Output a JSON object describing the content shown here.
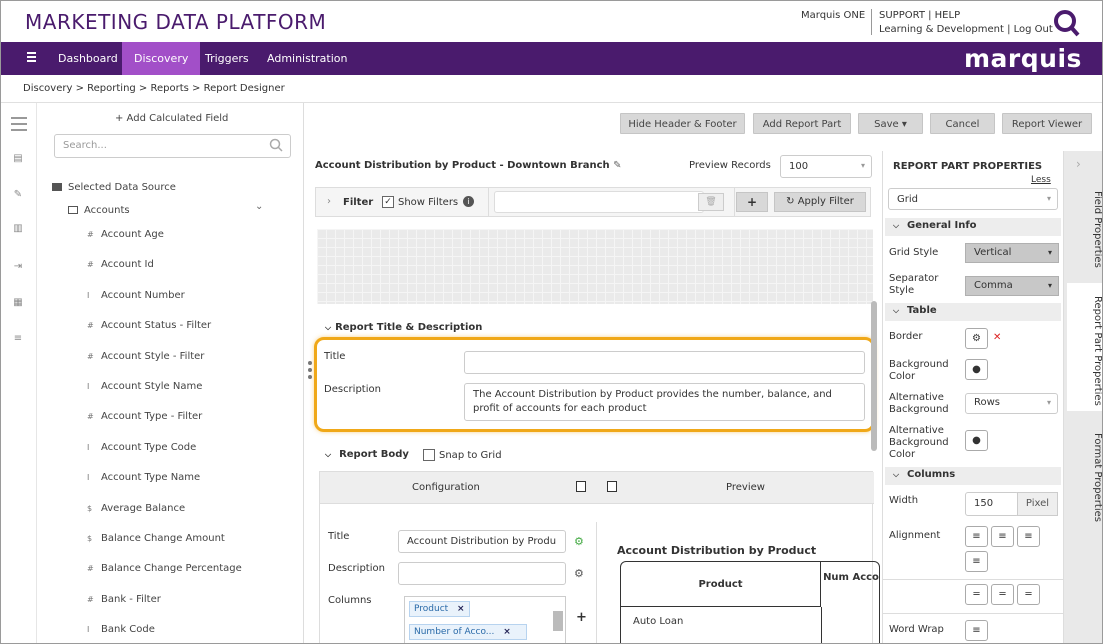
{
  "header": {
    "brand": "MARKETING DATA PLATFORM",
    "user": "Marquis ONE",
    "support": "SUPPORT | HELP",
    "learning": "Learning & Development | Log Out"
  },
  "nav": {
    "items": [
      "Dashboard",
      "Discovery",
      "Triggers",
      "Administration"
    ],
    "active": "Discovery",
    "logo": "marquis"
  },
  "breadcrumb": "Discovery  >  Reporting  >  Reports  >  Report Designer",
  "left_panel": {
    "add_calc": "+ Add Calculated Field",
    "search_placeholder": "Search...",
    "selected_source": "Selected Data Source",
    "source": "Accounts",
    "fields": [
      {
        "sym": "#",
        "name": "Account Age"
      },
      {
        "sym": "#",
        "name": "Account Id"
      },
      {
        "sym": "I",
        "name": "Account Number"
      },
      {
        "sym": "#",
        "name": "Account Status - Filter"
      },
      {
        "sym": "#",
        "name": "Account Style - Filter"
      },
      {
        "sym": "I",
        "name": "Account Style Name"
      },
      {
        "sym": "#",
        "name": "Account Type - Filter"
      },
      {
        "sym": "I",
        "name": "Account Type Code"
      },
      {
        "sym": "I",
        "name": "Account Type Name"
      },
      {
        "sym": "$",
        "name": "Average Balance"
      },
      {
        "sym": "$",
        "name": "Balance Change Amount"
      },
      {
        "sym": "#",
        "name": "Balance Change Percentage"
      },
      {
        "sym": "#",
        "name": "Bank - Filter"
      },
      {
        "sym": "I",
        "name": "Bank Code"
      }
    ]
  },
  "toolbar": {
    "hide": "Hide Header & Footer",
    "add_part": "Add Report Part",
    "save": "Save",
    "cancel": "Cancel",
    "viewer": "Report Viewer"
  },
  "report": {
    "title": "Account Distribution by Product - Downtown Branch",
    "preview_label": "Preview Records",
    "preview_value": "100"
  },
  "filter": {
    "label": "Filter",
    "show": "Show Filters",
    "apply": "Apply Filter"
  },
  "title_desc": {
    "section": "Report Title & Description",
    "title_label": "Title",
    "title_value": "",
    "desc_label": "Description",
    "desc_value": "The Account Distribution by Product provides the number, balance, and profit of accounts for each product"
  },
  "body": {
    "section": "Report Body",
    "snap": "Snap to Grid",
    "config": "Configuration",
    "preview": "Preview",
    "title_label": "Title",
    "title_value": "Account Distribution by Produ",
    "desc_label": "Description",
    "columns_label": "Columns",
    "chip1": "Product",
    "chip2": "Number of Acco...",
    "preview_title": "Account Distribution by Product",
    "col_product": "Product",
    "col_num": "Num Acco",
    "row1": "Auto Loan"
  },
  "right_panel": {
    "header": "REPORT PART PROPERTIES",
    "less": "Less",
    "type": "Grid",
    "general": "General Info",
    "grid_style_label": "Grid Style",
    "grid_style": "Vertical",
    "sep_label": "Separator Style",
    "sep": "Comma",
    "table": "Table",
    "border": "Border",
    "bg": "Background Color",
    "alt_bg": "Alternative Background",
    "alt_bg_val": "Rows",
    "alt_bg_color": "Alternative Background Color",
    "columns": "Columns",
    "width": "Width",
    "width_val": "150",
    "width_unit": "Pixel",
    "alignment": "Alignment",
    "word_wrap": "Word Wrap"
  },
  "side_tabs": [
    "Field Properties",
    "Report Part Properties",
    "Format Properties"
  ]
}
